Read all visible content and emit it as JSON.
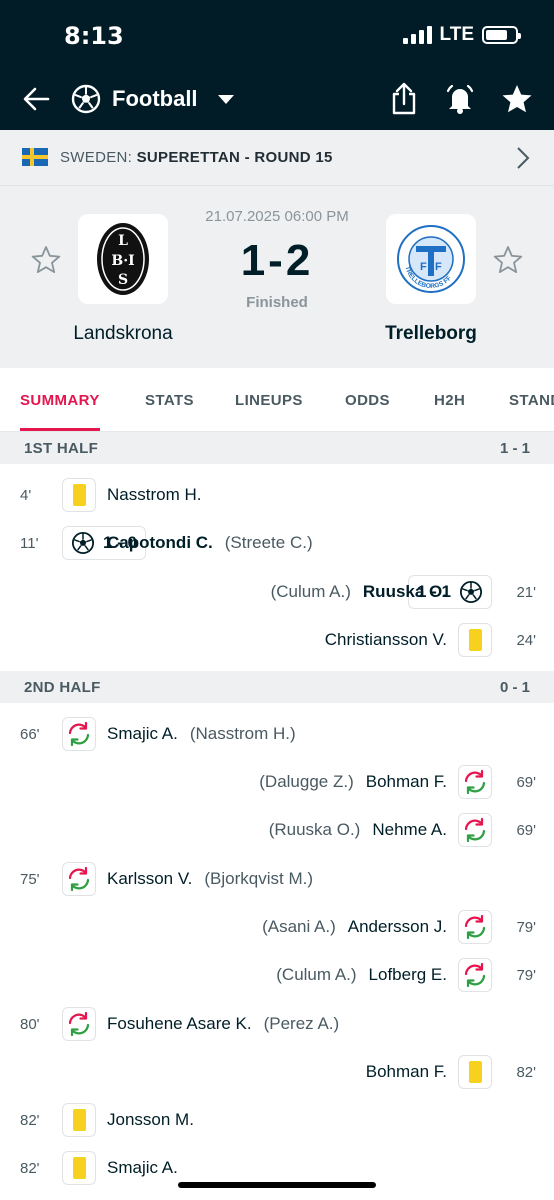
{
  "status_bar": {
    "time": "8:13",
    "network": "LTE",
    "battery_level": 0.75
  },
  "app_bar": {
    "title": "Football",
    "sport_icon": "football-icon",
    "back_icon": "arrow-left-icon",
    "share_icon": "share-icon",
    "bell_icon": "bell-icon",
    "star_icon": "star-icon"
  },
  "league": {
    "country": "SWEDEN: ",
    "name": "SUPERETTAN - ROUND 15"
  },
  "match": {
    "datetime": "21.07.2025 06:00 PM",
    "score": "1-2",
    "status": "Finished",
    "home": {
      "name": "Landskrona",
      "logo_text": "LBIS"
    },
    "away": {
      "name": "Trelleborg",
      "logo_text": "TRELLEBORGS FF"
    }
  },
  "tabs": [
    "SUMMARY",
    "STATS",
    "LINEUPS",
    "ODDS",
    "H2H",
    "STANDINGS"
  ],
  "active_tab": "SUMMARY",
  "halves": [
    {
      "label": "1ST HALF",
      "score": "1 - 1"
    },
    {
      "label": "2ND HALF",
      "score": "0 - 1"
    }
  ],
  "events": [
    {
      "side": "home",
      "minute": "4'",
      "type": "yellow-card",
      "player": "Nasstrom H.",
      "assist": ""
    },
    {
      "side": "home",
      "minute": "11'",
      "type": "goal",
      "score": "1 - 0",
      "player": "Capotondi C.",
      "assist": "(Streete C.)"
    },
    {
      "side": "away",
      "minute": "21'",
      "type": "goal",
      "score": "1 - 1",
      "player": "Ruuska O.",
      "assist": "(Culum A.)"
    },
    {
      "side": "away",
      "minute": "24'",
      "type": "yellow-card",
      "player": "Christiansson V.",
      "assist": ""
    },
    {
      "side": "home",
      "minute": "66'",
      "type": "substitution",
      "player": "Smajic A.",
      "assist": "(Nasstrom H.)"
    },
    {
      "side": "away",
      "minute": "69'",
      "type": "substitution",
      "player": "Bohman F.",
      "assist": "(Dalugge Z.)"
    },
    {
      "side": "away",
      "minute": "69'",
      "type": "substitution",
      "player": "Nehme A.",
      "assist": "(Ruuska O.)"
    },
    {
      "side": "home",
      "minute": "75'",
      "type": "substitution",
      "player": "Karlsson V.",
      "assist": "(Bjorkqvist M.)"
    },
    {
      "side": "away",
      "minute": "79'",
      "type": "substitution",
      "player": "Andersson J.",
      "assist": "(Asani A.)"
    },
    {
      "side": "away",
      "minute": "79'",
      "type": "substitution",
      "player": "Lofberg E.",
      "assist": "(Culum A.)"
    },
    {
      "side": "home",
      "minute": "80'",
      "type": "substitution",
      "player": "Fosuhene Asare K.",
      "assist": "(Perez A.)"
    },
    {
      "side": "away",
      "minute": "82'",
      "type": "yellow-card",
      "player": "Bohman F.",
      "assist": ""
    },
    {
      "side": "home",
      "minute": "82'",
      "type": "yellow-card",
      "player": "Jonsson M.",
      "assist": ""
    },
    {
      "side": "home",
      "minute": "82'",
      "type": "yellow-card",
      "player": "Smajic A.",
      "assist": ""
    }
  ],
  "colors": {
    "header": "#011c26",
    "accent": "#e5164e",
    "card": "#f7d11e",
    "sub_green": "#2ea043",
    "sub_red": "#e5164e"
  }
}
